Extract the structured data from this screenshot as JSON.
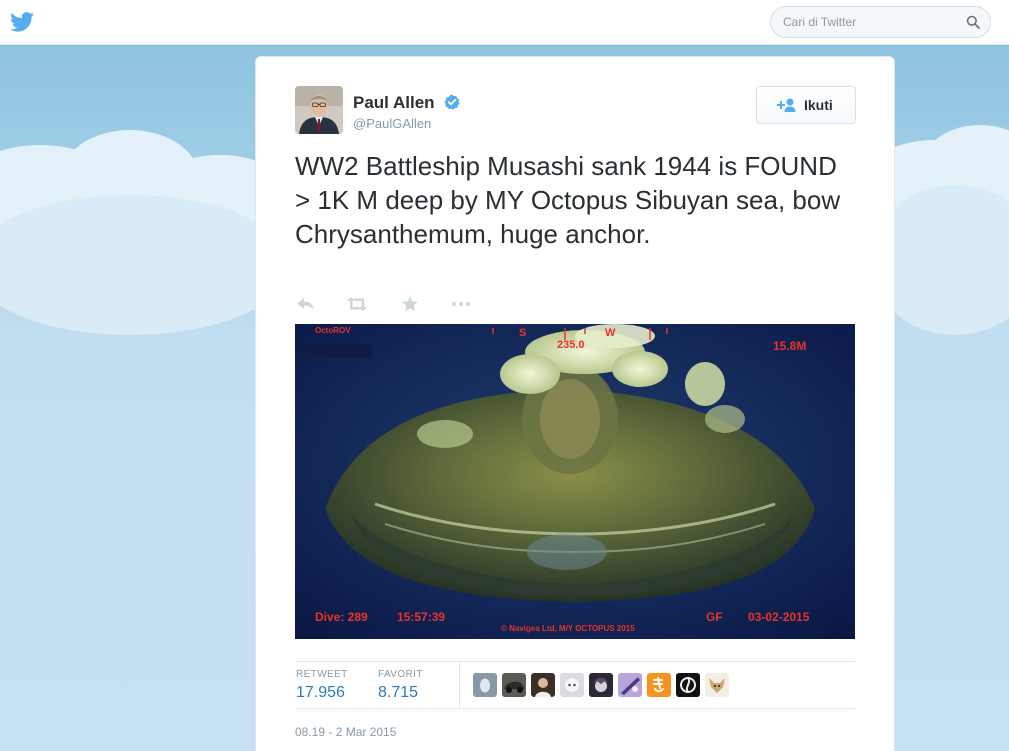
{
  "search": {
    "placeholder": "Cari di Twitter"
  },
  "tweet": {
    "author_name": "Paul Allen",
    "author_handle": "@PaulGAllen",
    "follow_label": "Ikuti",
    "text": "WW2 Battleship Musashi sank 1944 is FOUND > 1K M deep by MY Octopus Sibuyan sea, bow Chrysanthemum, huge anchor.",
    "actions": [
      "reply-icon",
      "retweet-icon",
      "favorite-icon",
      "more-icon"
    ],
    "media_overlay": {
      "top_left": "OctoROV",
      "compass_s": "S",
      "compass_w": "W",
      "heading": "235.0",
      "depth": "15.8M",
      "dive": "Dive: 289",
      "time": "15:57:39",
      "copyright": "© Navigea Ltd, M/Y OCTOPUS 2015",
      "gf": "GF",
      "date": "03-02-2015"
    },
    "stats": {
      "retweet_label": "RETWEET",
      "retweet_count": "17.956",
      "favorite_label": "FAVORIT",
      "favorite_count": "8.715"
    },
    "favoriter_avatars": [
      "avatar-grey-egg",
      "avatar-car",
      "avatar-person",
      "avatar-anime-white",
      "avatar-anime-dark",
      "avatar-purple-art",
      "avatar-orange-ki",
      "avatar-black-swirl",
      "avatar-anime-fox"
    ],
    "timestamp": "08.19 - 2 Mar 2015"
  },
  "colors": {
    "twitter_blue": "#55acee",
    "link_blue": "#2b7bb9",
    "overlay_red": "#e8322a"
  }
}
